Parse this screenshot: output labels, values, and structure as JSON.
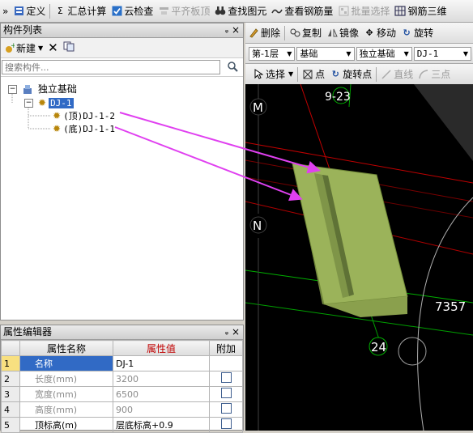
{
  "toolbar": {
    "items": [
      {
        "label": "»",
        "icon": "chevrons-icon"
      },
      {
        "label": "定义",
        "icon": "define-icon"
      },
      {
        "label": "汇总计算",
        "icon": "sigma-icon"
      },
      {
        "label": "云检查",
        "icon": "cloud-check-icon"
      },
      {
        "label": "平齐板顶",
        "icon": "align-top-icon",
        "disabled": true
      },
      {
        "label": "查找图元",
        "icon": "binoculars-icon"
      },
      {
        "label": "查看钢筋量",
        "icon": "view-rebar-icon"
      },
      {
        "label": "批量选择",
        "icon": "batch-select-icon",
        "disabled": true
      },
      {
        "label": "钢筋三维",
        "icon": "rebar-3d-icon"
      }
    ]
  },
  "component_list": {
    "title": "构件列表",
    "new_label": "新建",
    "search_placeholder": "搜索构件...",
    "tree": {
      "root": "独立基础",
      "child": "DJ-1",
      "leaves": [
        "(顶)DJ-1-2",
        "(底)DJ-1-1"
      ]
    }
  },
  "property_editor": {
    "title": "属性编辑器",
    "columns": {
      "name": "属性名称",
      "value": "属性值",
      "extra": "附加"
    },
    "rows": [
      {
        "num": "1",
        "name": "名称",
        "value": "DJ-1",
        "checkbox": false
      },
      {
        "num": "2",
        "name": "长度(mm)",
        "value": "3200",
        "checkbox": true
      },
      {
        "num": "3",
        "name": "宽度(mm)",
        "value": "6500",
        "checkbox": true
      },
      {
        "num": "4",
        "name": "高度(mm)",
        "value": "900",
        "checkbox": true
      },
      {
        "num": "5",
        "name": "顶标高(m)",
        "value": "层底标高+0.9",
        "checkbox": true
      }
    ]
  },
  "edit_toolbar": {
    "delete": "删除",
    "copy": "复制",
    "mirror": "镜像",
    "move": "移动",
    "rotate": "旋转"
  },
  "layer_bar": {
    "floor": "第-1层",
    "category": "基础",
    "type": "独立基础",
    "component": "DJ-1"
  },
  "select_bar": {
    "select": "选择",
    "point": "点",
    "rotate_point": "旋转点",
    "line": "直线",
    "three_point": "三点"
  },
  "canvas": {
    "labels": {
      "grid_top": "9-23",
      "axis_m": "M",
      "axis_n": "N",
      "dim": "7357",
      "grid_bottom": "24"
    },
    "colors": {
      "background": "#000000",
      "foundation": "#9bb35a",
      "arrow": "#e040f0",
      "red_line": "#d00000",
      "green_line": "#00c000"
    }
  }
}
